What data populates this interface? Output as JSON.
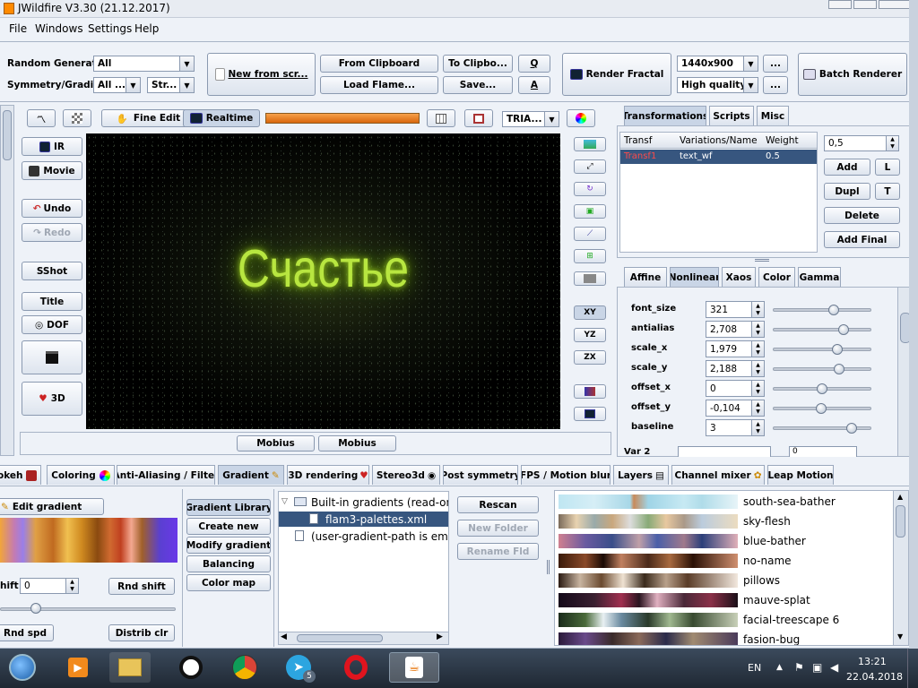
{
  "window": {
    "title": "JWildfire V3.30 (21.12.2017)"
  },
  "menu": [
    "File",
    "Windows",
    "Settings",
    "Help"
  ],
  "toolbar": {
    "random_generator_label": "Random Generator",
    "random_generator_value": "All",
    "symmetry_label": "Symmetry/Gradient",
    "symmetry_value": "All ...",
    "gradient_value": "Str...",
    "new_from_screen": "New from scr...",
    "from_clipboard": "From Clipboard",
    "to_clipboard": "To Clipbo...",
    "q": "Q",
    "load_flame": "Load Flame...",
    "save": "Save...",
    "a": "A",
    "render_fractal": "Render Fractal",
    "resolution": "1440x900",
    "quality": "High quality",
    "more1": "...",
    "more2": "...",
    "batch_renderer": "Batch Renderer"
  },
  "preview_toolbar": {
    "fine_edit": "Fine Edit",
    "realtime": "Realtime",
    "mode": "TRIA..."
  },
  "left_buttons": {
    "ir": "IR",
    "movie": "Movie",
    "undo": "Undo",
    "redo": "Redo",
    "sshot": "SShot",
    "title": "Title",
    "dof": "DOF",
    "threed": "3D"
  },
  "preview": {
    "text": "Счастье"
  },
  "mobius": [
    "Mobius",
    "Mobius"
  ],
  "axis_buttons": [
    "XY",
    "YZ",
    "ZX"
  ],
  "right_tabs": [
    "Transformations",
    "Scripts",
    "Misc"
  ],
  "transform_table": {
    "headers": [
      "Transf",
      "Variations/Name",
      "Weight"
    ],
    "rows": [
      [
        "Transf1",
        "text_wf",
        "0.5"
      ]
    ]
  },
  "transform_controls": {
    "weight": "0,5",
    "add": "Add",
    "l": "L",
    "dupl": "Dupl",
    "t": "T",
    "delete": "Delete",
    "add_final": "Add Final"
  },
  "sub_tabs": [
    "Affine",
    "Nonlinear",
    "Xaos",
    "Color",
    "Gamma"
  ],
  "params": [
    {
      "name": "font_size",
      "value": "321",
      "slider": 0.62
    },
    {
      "name": "antialias",
      "value": "2,708",
      "slider": 0.72
    },
    {
      "name": "scale_x",
      "value": "1,979",
      "slider": 0.65
    },
    {
      "name": "scale_y",
      "value": "2,188",
      "slider": 0.67
    },
    {
      "name": "offset_x",
      "value": "0",
      "slider": 0.5
    },
    {
      "name": "offset_y",
      "value": "-0,104",
      "slider": 0.49
    },
    {
      "name": "baseline",
      "value": "3",
      "slider": 0.8
    }
  ],
  "var2": {
    "label": "Var 2",
    "value": "0"
  },
  "bottom_tabs": [
    "okeh",
    "Coloring",
    "Anti-Aliasing / Filter",
    "Gradient",
    "3D rendering",
    "Stereo3d",
    "Post symmetry",
    "FPS / Motion blur",
    "Layers",
    "Channel mixer",
    "Leap Motion"
  ],
  "gradient": {
    "edit_gradient": "Edit gradient",
    "shift_label": "hift",
    "shift_value": "0",
    "rnd_shift": "Rnd shift",
    "rnd_spd": "Rnd spd",
    "distrib_clr": "Distrib clr",
    "library": "Gradient Library",
    "create_new": "Create new",
    "modify": "Modify gradient",
    "balancing": "Balancing",
    "color_map": "Color map",
    "tree": [
      "Built-in gradients (read-only)",
      "flam3-palettes.xml",
      "(user-gradient-path is empty)"
    ],
    "rescan": "Rescan",
    "new_folder": "New Folder",
    "rename": "Rename Fld"
  },
  "palettes": [
    "south-sea-bather",
    "sky-flesh",
    "blue-bather",
    "no-name",
    "pillows",
    "mauve-splat",
    "facial-treescape 6",
    "fasion-bug"
  ],
  "taskbar": {
    "lang": "EN",
    "time": "13:21",
    "date": "22.04.2018",
    "badge": "5"
  }
}
